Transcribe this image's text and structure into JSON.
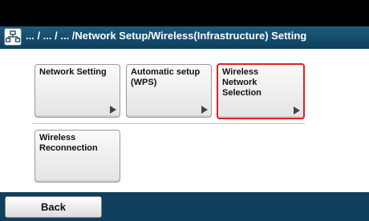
{
  "title": {
    "icon": "network-icon",
    "text": "... / ... / ... /Network Setup/Wireless(Infrastructure) Setting"
  },
  "menu": {
    "items": [
      {
        "label": "Network Setting",
        "arrow": true,
        "selected": false
      },
      {
        "label": "Automatic setup (WPS)",
        "arrow": true,
        "selected": false
      },
      {
        "label": "Wireless Network Selection",
        "arrow": true,
        "selected": true
      },
      {
        "label": "Wireless Reconnection",
        "arrow": false,
        "selected": false
      }
    ]
  },
  "footer": {
    "back_label": "Back"
  },
  "colors": {
    "title_bar": "#0f3f5c",
    "selected_border": "#e0221e",
    "background": "#ffffff"
  }
}
